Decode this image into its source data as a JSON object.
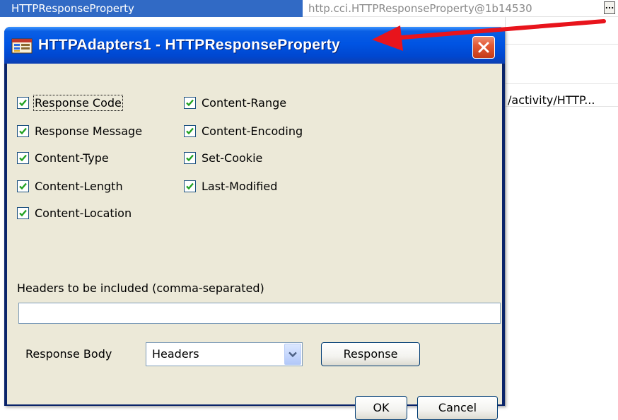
{
  "background": {
    "property_name": "HTTPResponseProperty",
    "property_value": "http.cci.HTTPResponseProperty@1b14530",
    "ellipsis_label": "...",
    "activity_text": "/activity/HTTP..."
  },
  "dialog": {
    "title": "HTTPAdapters1 - HTTPResponseProperty",
    "checkboxes_left": [
      {
        "label": "Response Code",
        "checked": true
      },
      {
        "label": "Response Message",
        "checked": true
      },
      {
        "label": "Content-Type",
        "checked": true
      },
      {
        "label": "Content-Length",
        "checked": true
      },
      {
        "label": "Content-Location",
        "checked": true
      }
    ],
    "checkboxes_right": [
      {
        "label": "Content-Range",
        "checked": true
      },
      {
        "label": "Content-Encoding",
        "checked": true
      },
      {
        "label": "Set-Cookie",
        "checked": true
      },
      {
        "label": "Last-Modified",
        "checked": true
      }
    ],
    "headers_label": "Headers to be included (comma-separated)",
    "headers_value": "",
    "response_body_label": "Response Body",
    "response_body_selected": "Headers",
    "response_button": "Response",
    "ok_button": "OK",
    "cancel_button": "Cancel"
  },
  "colors": {
    "title_bar": "#0054e3",
    "selected_row": "#316ac5",
    "dialog_face": "#ece9d8",
    "close_button": "#e35a36",
    "annotation_arrow": "#e8141c",
    "checkmark": "#21a121"
  },
  "icons": {
    "title_icon": "properties-icon",
    "close_icon": "close-x-icon",
    "checkbox_icon": "checkmark-icon",
    "dropdown_icon": "chevron-down-icon"
  }
}
